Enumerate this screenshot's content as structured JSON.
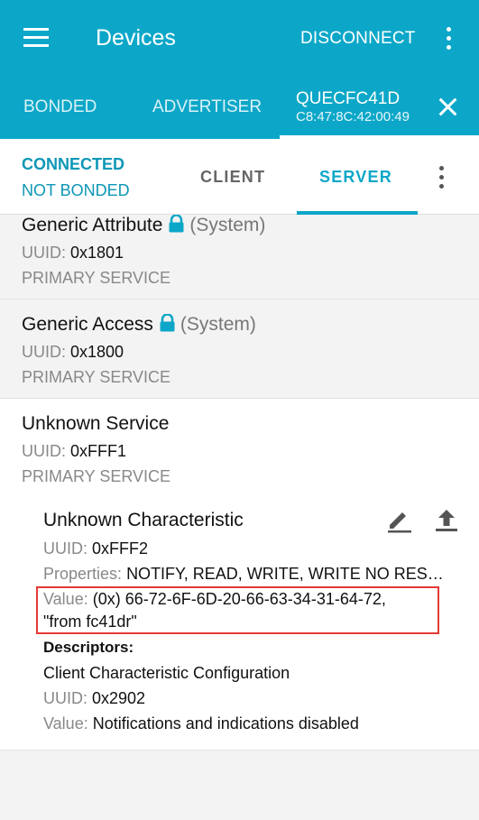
{
  "appbar": {
    "title": "Devices",
    "disconnect_label": "DISCONNECT",
    "tabs": [
      {
        "label": "BONDED"
      },
      {
        "label": "ADVERTISER"
      }
    ],
    "device": {
      "name": "QUECFC41D",
      "address": "C8:47:8C:42:00:49"
    }
  },
  "connection": {
    "status": "CONNECTED",
    "bond_status": "NOT BONDED",
    "tabs": [
      {
        "label": "CLIENT"
      },
      {
        "label": "SERVER"
      }
    ],
    "active_tab": "SERVER"
  },
  "services": [
    {
      "name": "Generic Attribute",
      "system_label": "(System)",
      "uuid_label": "UUID:",
      "uuid": "0x1801",
      "type": "PRIMARY SERVICE"
    },
    {
      "name": "Generic Access",
      "system_label": "(System)",
      "uuid_label": "UUID:",
      "uuid": "0x1800",
      "type": "PRIMARY SERVICE"
    },
    {
      "name": "Unknown Service",
      "uuid_label": "UUID:",
      "uuid": "0xFFF1",
      "type": "PRIMARY SERVICE",
      "characteristic": {
        "name": "Unknown Characteristic",
        "uuid_label": "UUID:",
        "uuid": "0xFFF2",
        "properties_label": "Properties:",
        "properties": "NOTIFY, READ, WRITE, WRITE NO RES…",
        "value_label": "Value:",
        "value_line1": "(0x) 66-72-6F-6D-20-66-63-34-31-64-72,",
        "value_line2": "\"from fc41dr\"",
        "descriptors_label": "Descriptors:",
        "descriptor": {
          "name": "Client Characteristic Configuration",
          "uuid_label": "UUID:",
          "uuid": "0x2902",
          "value_label": "Value:",
          "value": "Notifications and indications disabled"
        }
      }
    }
  ],
  "colors": {
    "primary": "#0ca7c8",
    "accent_text": "#0d97b6",
    "highlight": "#e53935"
  },
  "icons": [
    "menu-icon",
    "more-vert-icon",
    "close-icon",
    "lock-icon",
    "edit-icon",
    "upload-icon"
  ]
}
